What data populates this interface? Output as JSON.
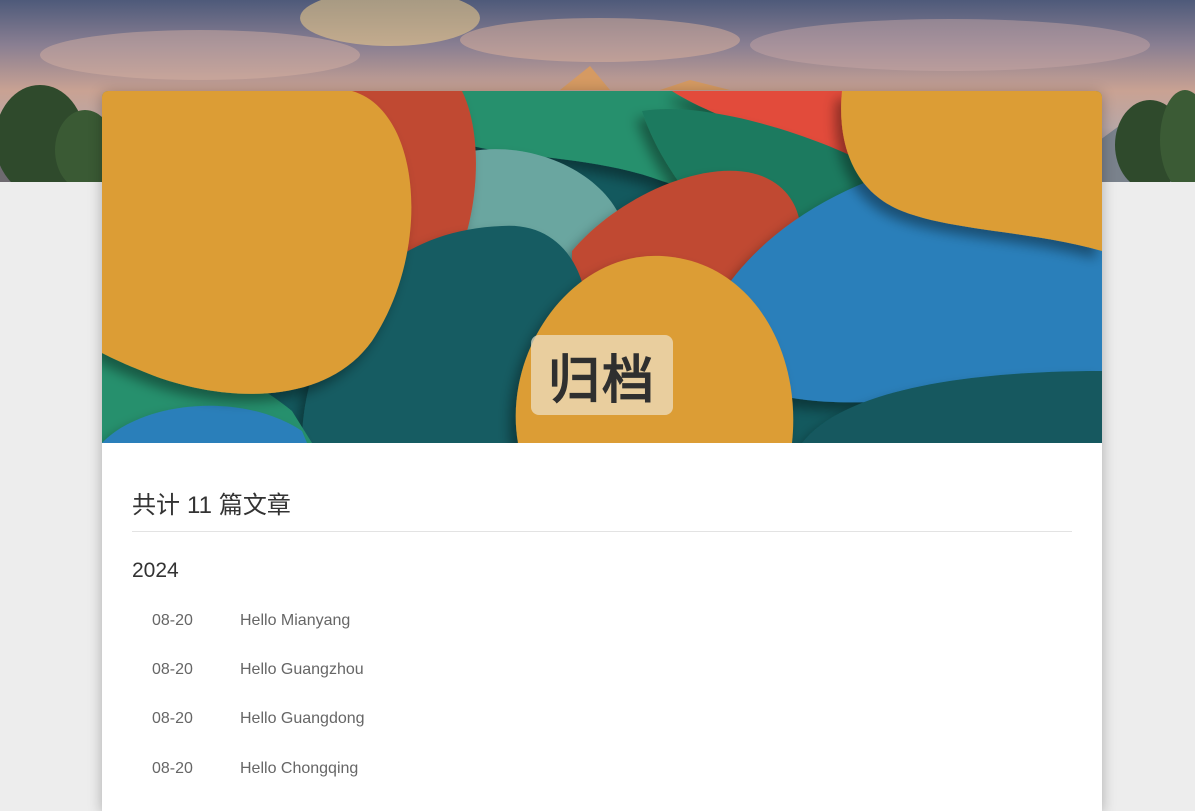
{
  "page": {
    "title": "归档",
    "total": {
      "prefix": "共计",
      "count": "11",
      "suffix": "篇文章"
    }
  },
  "archive": {
    "years": [
      {
        "year": "2024",
        "posts": [
          {
            "date": "08-20",
            "title": "Hello Mianyang"
          },
          {
            "date": "08-20",
            "title": "Hello Guangzhou"
          },
          {
            "date": "08-20",
            "title": "Hello Guangdong"
          },
          {
            "date": "08-20",
            "title": "Hello Chongqing"
          }
        ]
      }
    ]
  },
  "colors": {
    "page_background": "#ededed",
    "card_background": "#ffffff",
    "cover_mustard": "#dc9d34",
    "cover_teal": "#13595e",
    "cover_blue": "#2a7fba",
    "cover_green": "#27906d",
    "cover_red": "#c04a30"
  }
}
